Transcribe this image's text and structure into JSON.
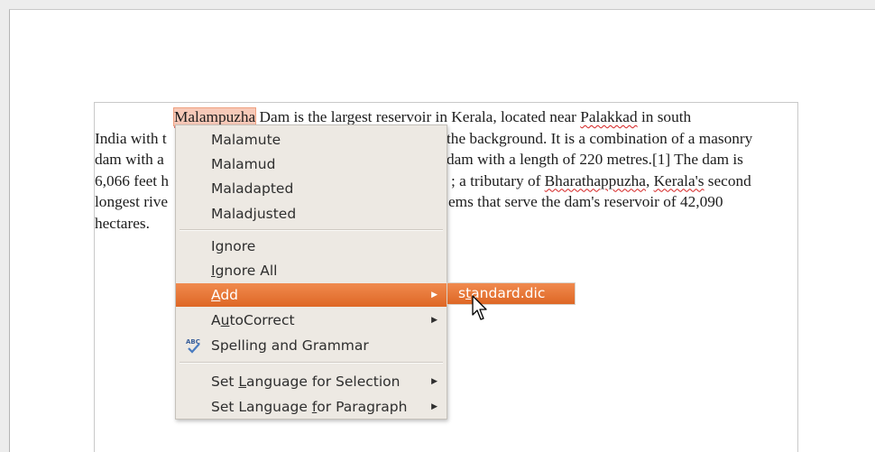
{
  "document": {
    "lines": [
      {
        "pre": "",
        "word": "Malampuzha",
        "a": " Dam is the largest reservoir in Kerala, located near ",
        "b": "Palakkad",
        "c": " in south"
      },
      {
        "left": "India with t",
        "right": "the background. It is a combination of a masonry"
      },
      {
        "left": "dam with a",
        "right": "dam with a length of 220 metres.[1] The dam is"
      },
      {
        "left": "6,066 feet h",
        "right_a": "; a tributary of ",
        "right_b": "Bharathappuzha",
        "right_c": ", ",
        "right_d": "Kerala's",
        "right_e": " second"
      },
      {
        "left": "longest rive",
        "right": "ems that serve the dam's reservoir of 42,090"
      },
      {
        "left": "hectares.",
        "right": ""
      }
    ]
  },
  "context_menu": {
    "suggestions": [
      "Malamute",
      "Malamud",
      "Maladapted",
      "Maladjusted"
    ],
    "ignore": "Ignore",
    "ignore_all_u": "I",
    "ignore_all_rest": "gnore All",
    "add_u": "A",
    "add_rest": "dd",
    "autocorrect_a": "A",
    "autocorrect_u": "u",
    "autocorrect_rest": "toCorrect",
    "spelling": "Spelling and Grammar",
    "set_lang_sel_a": "Set ",
    "set_lang_sel_u": "L",
    "set_lang_sel_rest": "anguage for Selection",
    "set_lang_par_a": "Set Language ",
    "set_lang_par_u": "f",
    "set_lang_par_rest": "or Paragraph",
    "arrow": "▶"
  },
  "submenu": {
    "item_a": "s",
    "item_u": "t",
    "item_rest": "andard.dic"
  },
  "colors": {
    "highlight": "#e8763a",
    "misspelled_underline": "#d42020"
  }
}
